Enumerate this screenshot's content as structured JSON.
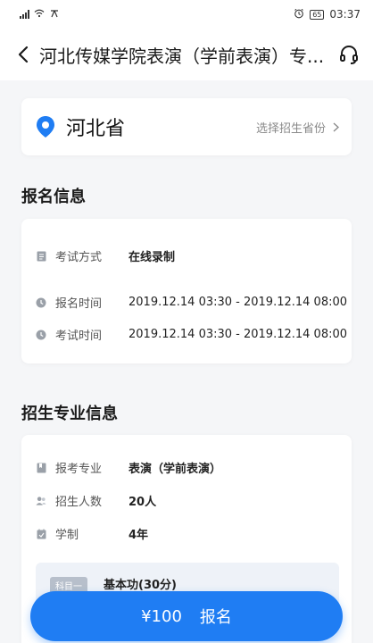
{
  "status_bar": {
    "left_text": "ᵍ᷊",
    "battery": "65",
    "time": "03:37"
  },
  "nav": {
    "title": "河北传媒学院表演（学前表演）专..."
  },
  "province": {
    "name": "河北省",
    "select_label": "选择招生省份"
  },
  "registration": {
    "section_title": "报名信息",
    "rows": [
      {
        "label": "考试方式",
        "value": "在线录制"
      },
      {
        "label": "报名时间",
        "value": "2019.12.14 03:30 - 2019.12.14 08:00"
      },
      {
        "label": "考试时间",
        "value": "2019.12.14 03:30 - 2019.12.14 08:00"
      }
    ]
  },
  "major": {
    "section_title": "招生专业信息",
    "rows": [
      {
        "label": "报考专业",
        "value": "表演（学前表演）"
      },
      {
        "label": "招生人数",
        "value": "20人"
      },
      {
        "label": "学制",
        "value": "4年"
      }
    ],
    "subject": {
      "tag": "科目一",
      "name": "基本功(30分)"
    }
  },
  "footer": {
    "price": "¥100",
    "action": "报名"
  },
  "colors": {
    "accent": "#1f7df3",
    "background": "#f5f6f8"
  }
}
